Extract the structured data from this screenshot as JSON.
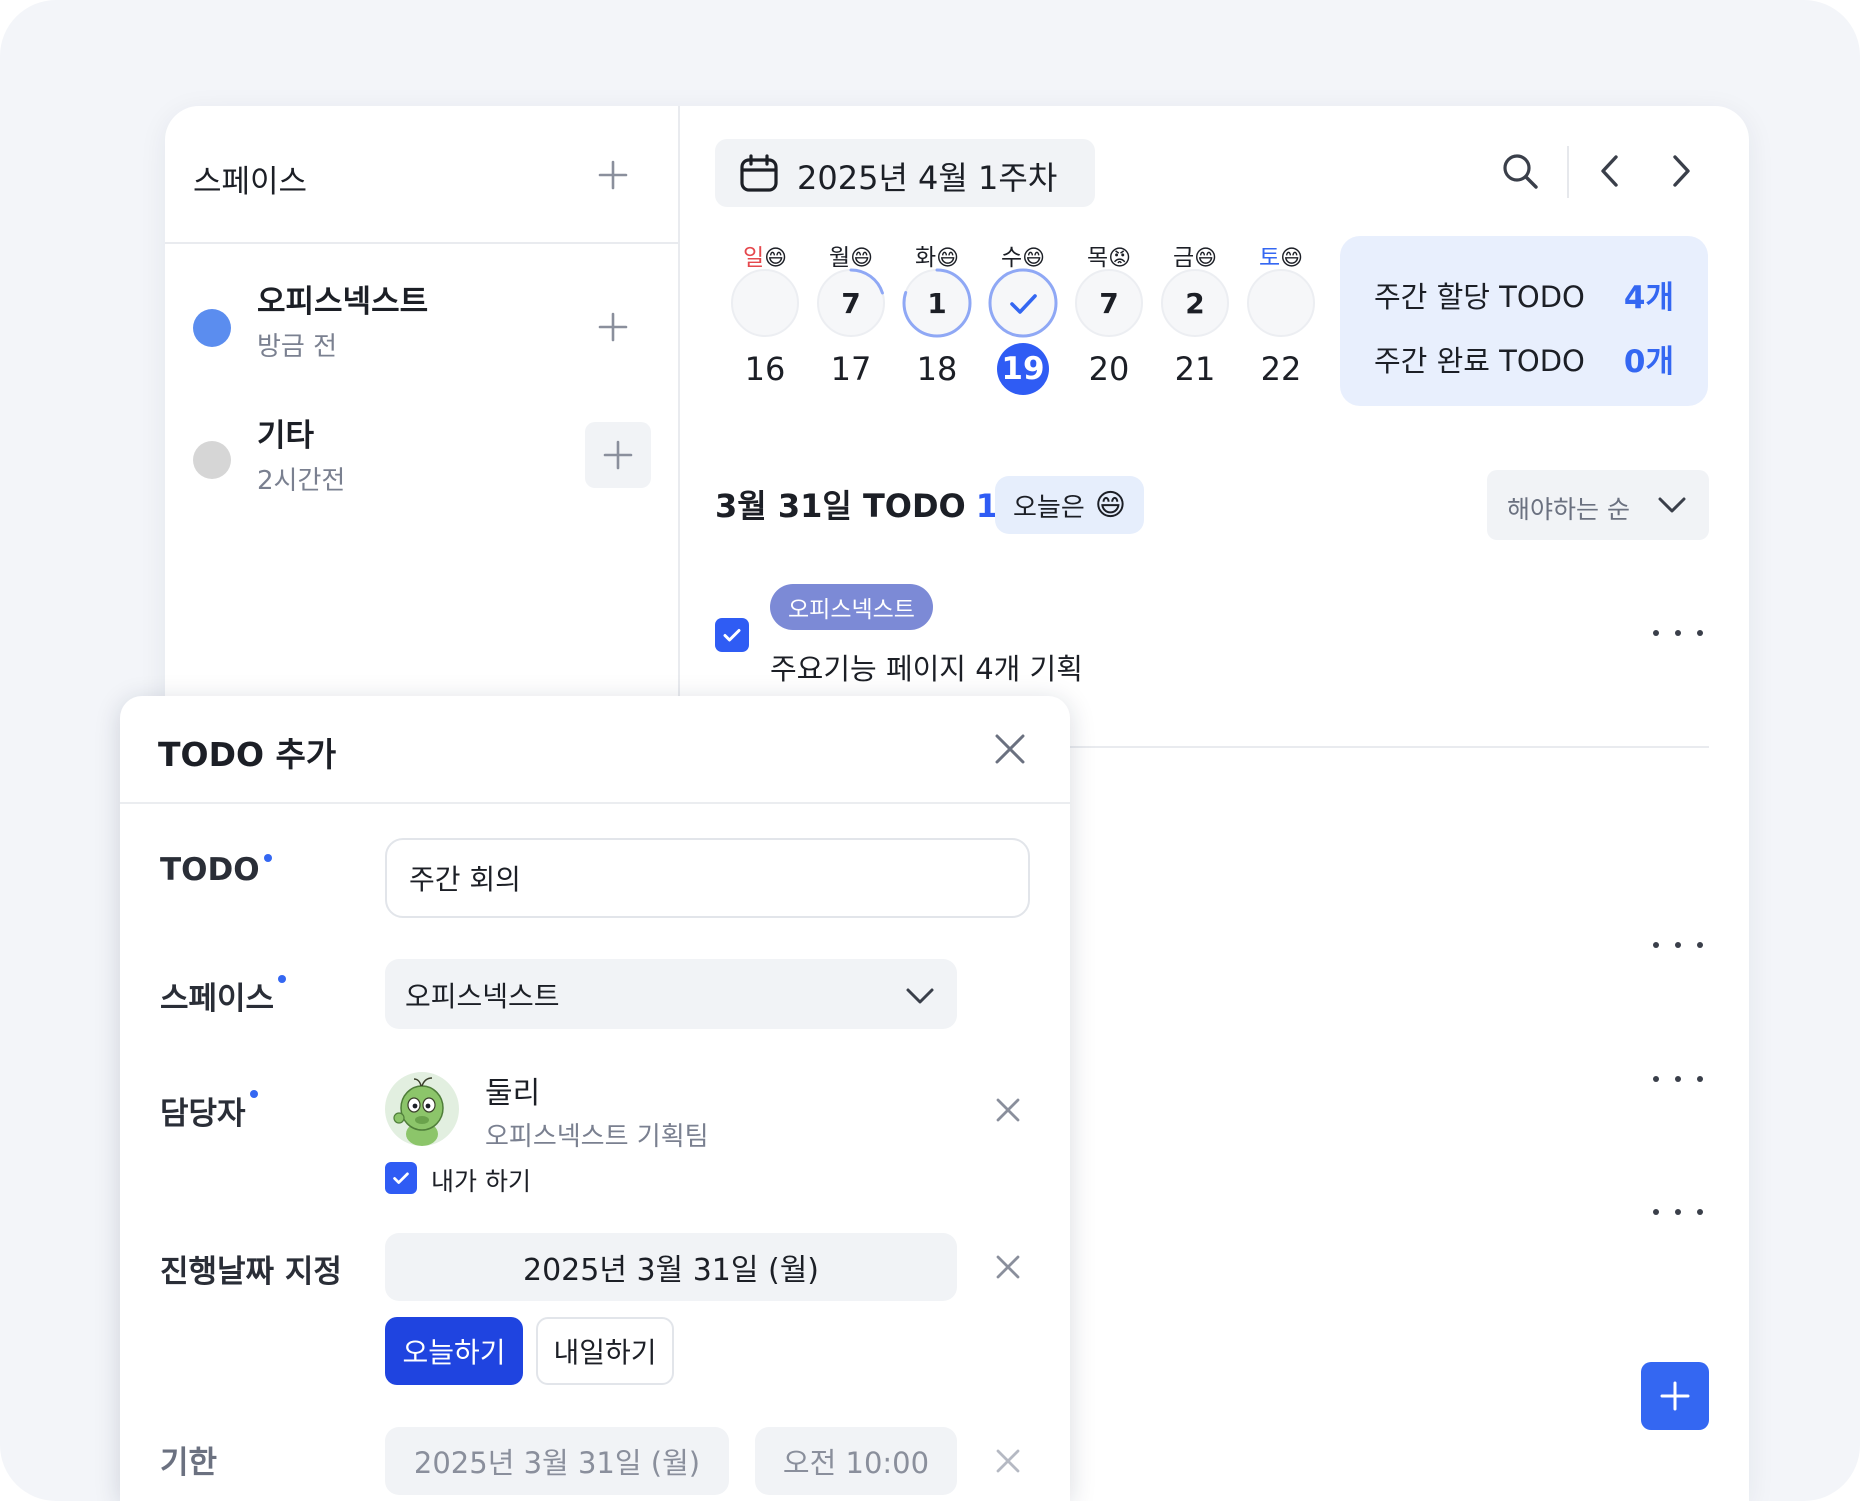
{
  "sidebar": {
    "title": "스페이스",
    "spaces": [
      {
        "name": "오피스넥스트",
        "time": "방금 전",
        "color": "#5b8def"
      },
      {
        "name": "기타",
        "time": "2시간전",
        "color": "#d6d6d6"
      }
    ]
  },
  "header": {
    "week_label": "2025년 4월 1주차",
    "icons": [
      "calendar-icon",
      "search-icon",
      "chevron-left-icon",
      "chevron-right-icon"
    ]
  },
  "week": [
    {
      "day": "일",
      "emoji": "😄",
      "count": "",
      "date": "16",
      "progress": 0,
      "day_color": "#e5484d"
    },
    {
      "day": "월",
      "emoji": "😄",
      "count": "7",
      "date": "17",
      "progress": 0.2,
      "day_color": "#1c1f26"
    },
    {
      "day": "화",
      "emoji": "😄",
      "count": "1",
      "date": "18",
      "progress": 0.8,
      "day_color": "#1c1f26"
    },
    {
      "day": "수",
      "emoji": "😄",
      "count": "",
      "date": "19",
      "progress": 1,
      "day_color": "#1c1f26",
      "done": true,
      "today": true
    },
    {
      "day": "목",
      "emoji": "😡",
      "count": "7",
      "date": "20",
      "progress": 0,
      "day_color": "#1c1f26"
    },
    {
      "day": "금",
      "emoji": "😄",
      "count": "2",
      "date": "21",
      "progress": 0,
      "day_color": "#1c1f26"
    },
    {
      "day": "토",
      "emoji": "😄",
      "count": "",
      "date": "22",
      "progress": 0,
      "day_color": "#3467f2"
    }
  ],
  "stats": {
    "assigned_label": "주간 할당 TODO",
    "assigned_value": "4개",
    "completed_label": "주간 완료 TODO",
    "completed_value": "0개"
  },
  "todo_section": {
    "title": "3월 31일 TODO",
    "count": "1",
    "mood_label": "오늘은",
    "mood_emoji": "😄",
    "sort_label": "해야하는 순"
  },
  "todos": [
    {
      "tag": "오피스넥스트",
      "title": "주요기능 페이지 4개 기획",
      "checked": true
    }
  ],
  "modal": {
    "title": "TODO 추가",
    "todo_label": "TODO",
    "todo_value": "주간 회의",
    "space_label": "스페이스",
    "space_value": "오피스넥스트",
    "assignee_label": "담당자",
    "assignee_name": "둘리",
    "assignee_team": "오피스넥스트 기획팀",
    "self_assign_label": "내가 하기",
    "progress_date_label": "진행날짜 지정",
    "progress_date_value": "2025년 3월 31일 (월)",
    "today_button": "오늘하기",
    "tomorrow_button": "내일하기",
    "due_label": "기한",
    "due_date_value": "2025년 3월 31일 (월)",
    "due_time_value": "오전 10:00"
  },
  "colors": {
    "accent": "#3467f2",
    "tag": "#7c8ad6",
    "primary_button": "#1f44e0"
  }
}
